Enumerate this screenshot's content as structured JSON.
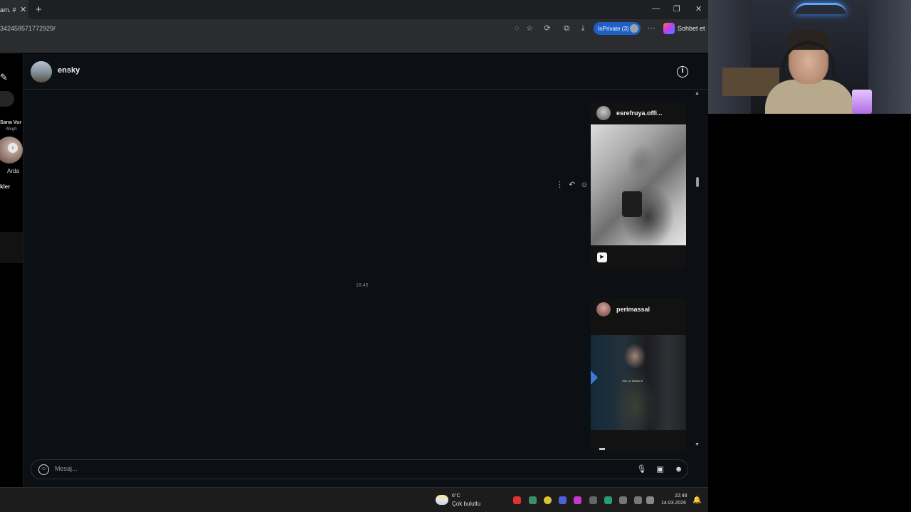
{
  "browser": {
    "tab_title": "am. #",
    "url": "342459571772929/",
    "inprivate_label": "InPrivate (3)",
    "chat_label": "Sohbet et"
  },
  "left_panel": {
    "note_name": "Sana Vur",
    "note_sub": "Wegh",
    "note_person": "Arda",
    "section_label": "kler"
  },
  "chat": {
    "username": "ensky",
    "timestamp": "16:45",
    "cards": [
      {
        "user": "esrefruya.offi...",
        "type": "reel"
      },
      {
        "user": "perimassal",
        "type": "reel",
        "subtitle": "Sen ne bilirsin ki"
      }
    ],
    "composer_placeholder": "Mesaj..."
  },
  "taskbar": {
    "temp": "6°C",
    "weather": "Çok bulutlu",
    "time": "22:48",
    "date": "14.03.2026"
  },
  "colors": {
    "chat_bg": "#0c1014",
    "inprivate": "#1f5fc6"
  }
}
